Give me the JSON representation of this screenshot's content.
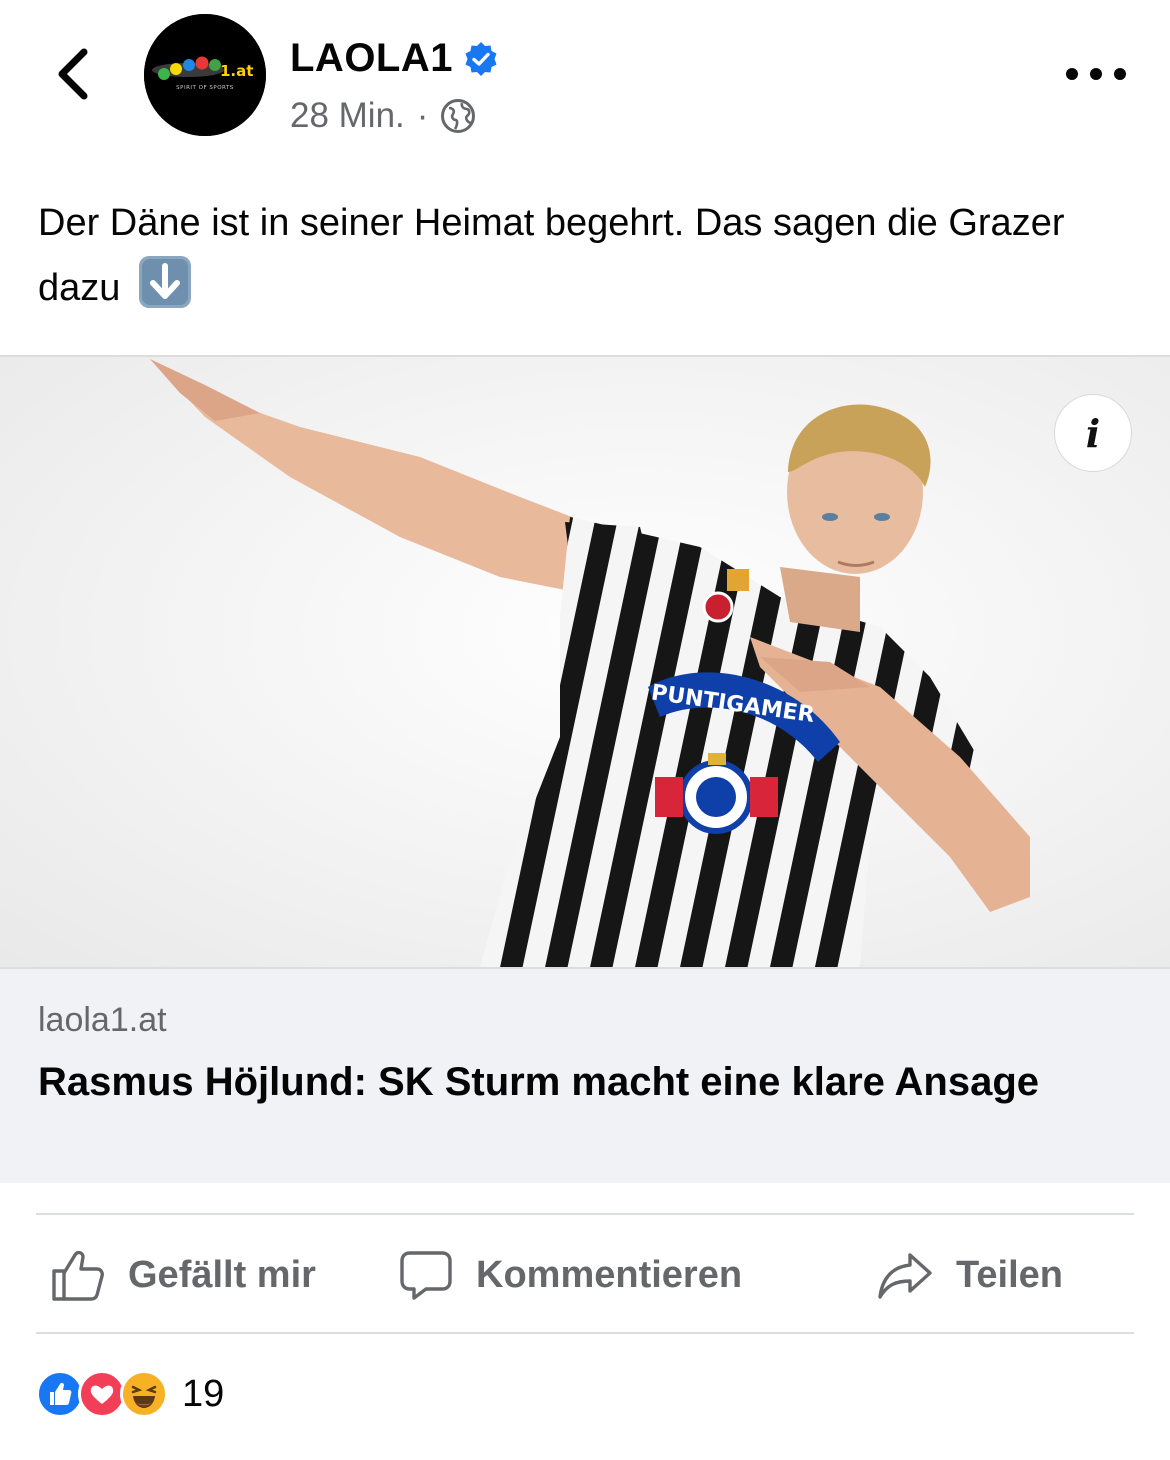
{
  "header": {
    "page_name": "LAOLA1",
    "time": "28 Min.",
    "separator": "·",
    "avatar_logo": "LAOLA1.at",
    "avatar_tagline": "SPIRIT OF SPORTS",
    "icons": {
      "back": "chevron-left-icon",
      "verified": "verified-badge-icon",
      "audience": "globe-icon",
      "more": "more-horizontal-icon"
    }
  },
  "post": {
    "text": "Der Däne ist in seiner Heimat begehrt. Das sagen die Grazer dazu",
    "emoji": "arrow-down-emoji"
  },
  "link_preview": {
    "image_sponsor_text": "PUNTIGAMER",
    "domain": "laola1.at",
    "title": "Rasmus Höjlund: SK Sturm macht eine klare Ansage",
    "info_label": "i"
  },
  "actions": {
    "like_label": "Gefällt mir",
    "comment_label": "Kommentieren",
    "share_label": "Teilen"
  },
  "reactions": {
    "types": [
      "like",
      "love",
      "haha"
    ],
    "count": "19"
  },
  "colors": {
    "facebook_blue": "#1877f2",
    "text_primary": "#050505",
    "text_secondary": "#65676b",
    "card_background": "#f0f2f5",
    "love_red": "#f33e58",
    "haha_yellow": "#f7b125"
  }
}
